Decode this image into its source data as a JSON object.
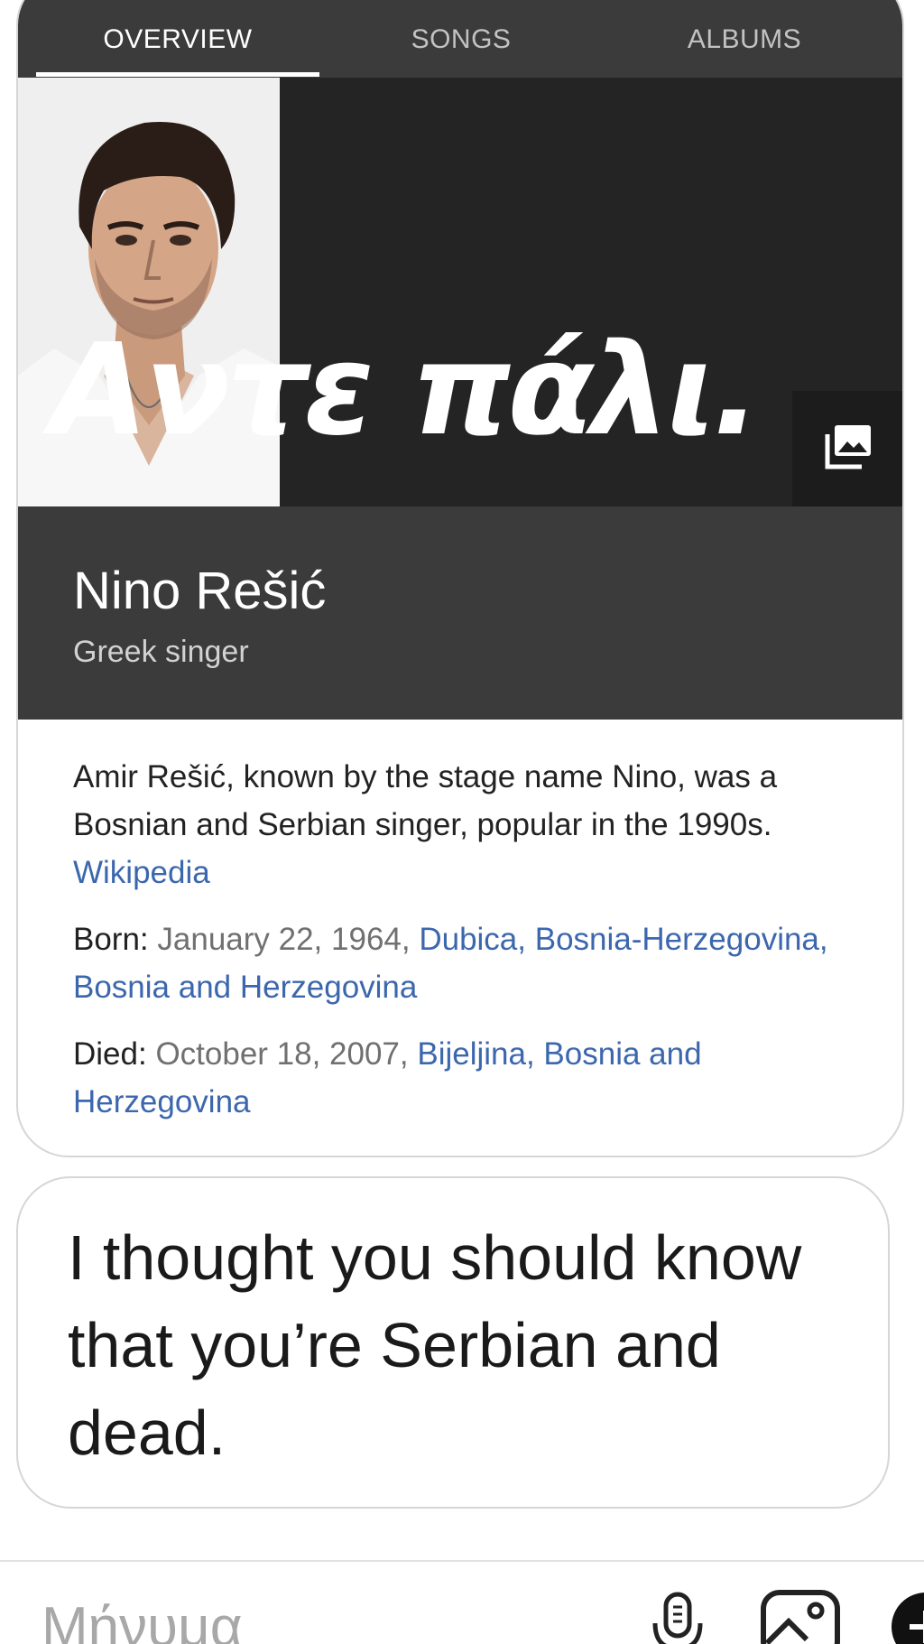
{
  "tabs": {
    "overview": "OVERVIEW",
    "songs": "SONGS",
    "albums": "ALBUMS"
  },
  "hero": {
    "caption": "Αντε πάλι.",
    "photo_icon": "person-portrait",
    "gallery_icon": "photo-gallery-icon"
  },
  "entity": {
    "name": "Nino Rešić",
    "description": "Greek singer"
  },
  "summary": {
    "text": "Amir Rešić, known by the stage name Nino, was a Bosnian and Serbian singer, popular in the 1990s.",
    "source": "Wikipedia"
  },
  "facts": {
    "born_label": "Born: ",
    "born_date": "January 22, 1964, ",
    "born_place": "Dubica, Bosnia-Herzegovina, Bosnia and Herzegovina",
    "died_label": "Died: ",
    "died_date": "October 18, 2007, ",
    "died_place": "Bijeljina, Bosnia and Herzegovina"
  },
  "message": {
    "text": "I thought you should know that you’re Serbian and dead."
  },
  "composer": {
    "placeholder": "Μήνυμα",
    "mic_icon": "microphone-icon",
    "image_icon": "image-icon",
    "send_icon": "send-icon"
  },
  "colors": {
    "card_dark": "#3b3b3b",
    "hero_dark": "#242424",
    "link": "#3c67ad",
    "border": "#d6d6d6"
  }
}
